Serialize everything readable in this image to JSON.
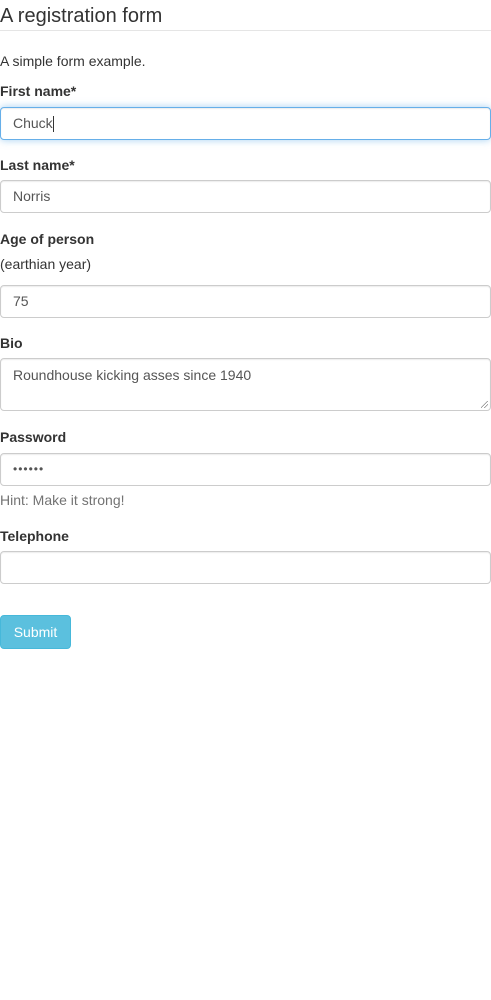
{
  "header": {
    "title": "A registration form"
  },
  "description": "A simple form example.",
  "fields": {
    "first_name": {
      "label": "First name*",
      "value": "Chuck"
    },
    "last_name": {
      "label": "Last name*",
      "value": "Norris"
    },
    "age": {
      "label": "Age of person",
      "sublabel": "(earthian year)",
      "value": "75"
    },
    "bio": {
      "label": "Bio",
      "value": "Roundhouse kicking asses since 1940"
    },
    "password": {
      "label": "Password",
      "value": "••••••",
      "hint": "Hint: Make it strong!"
    },
    "telephone": {
      "label": "Telephone",
      "value": ""
    }
  },
  "submit_label": "Submit",
  "colors": {
    "accent": "#5bc0de",
    "focus": "#66afe9"
  }
}
